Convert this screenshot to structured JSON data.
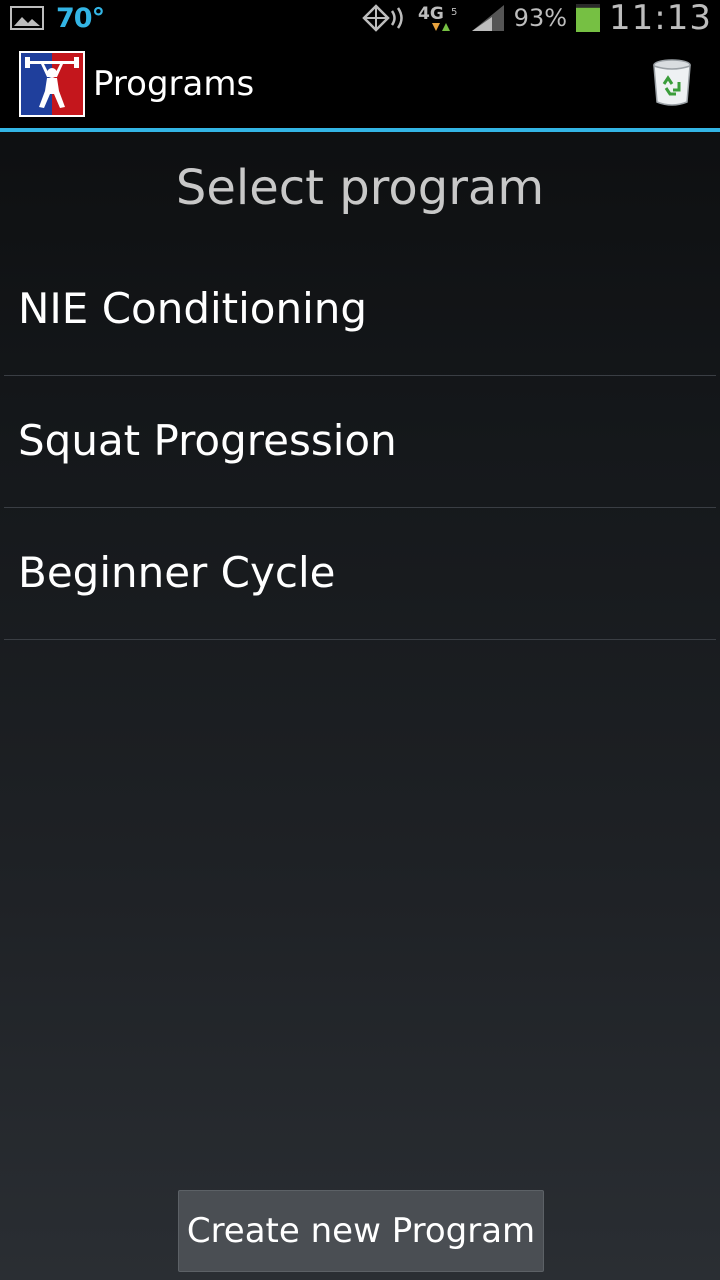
{
  "status_bar": {
    "temperature": "70°",
    "network": "4G",
    "battery_percent": "93%",
    "battery_level": 0.93,
    "time": "11:13",
    "icons": [
      "gallery-icon",
      "nfc-icon",
      "network-4g-icon",
      "signal-icon",
      "battery-icon"
    ]
  },
  "action_bar": {
    "title": "Programs",
    "icons": [
      "app-logo-icon",
      "trash-icon"
    ]
  },
  "main": {
    "heading": "Select program",
    "programs": [
      {
        "label": "NIE Conditioning"
      },
      {
        "label": "Squat Progression"
      },
      {
        "label": "Beginner Cycle"
      }
    ],
    "create_button": "Create new Program"
  },
  "colors": {
    "accent": "#33b5e5",
    "background_top": "#0b0c0d",
    "background_bottom": "#2a2e33",
    "button": "#4a4e53",
    "battery": "#76c043"
  }
}
